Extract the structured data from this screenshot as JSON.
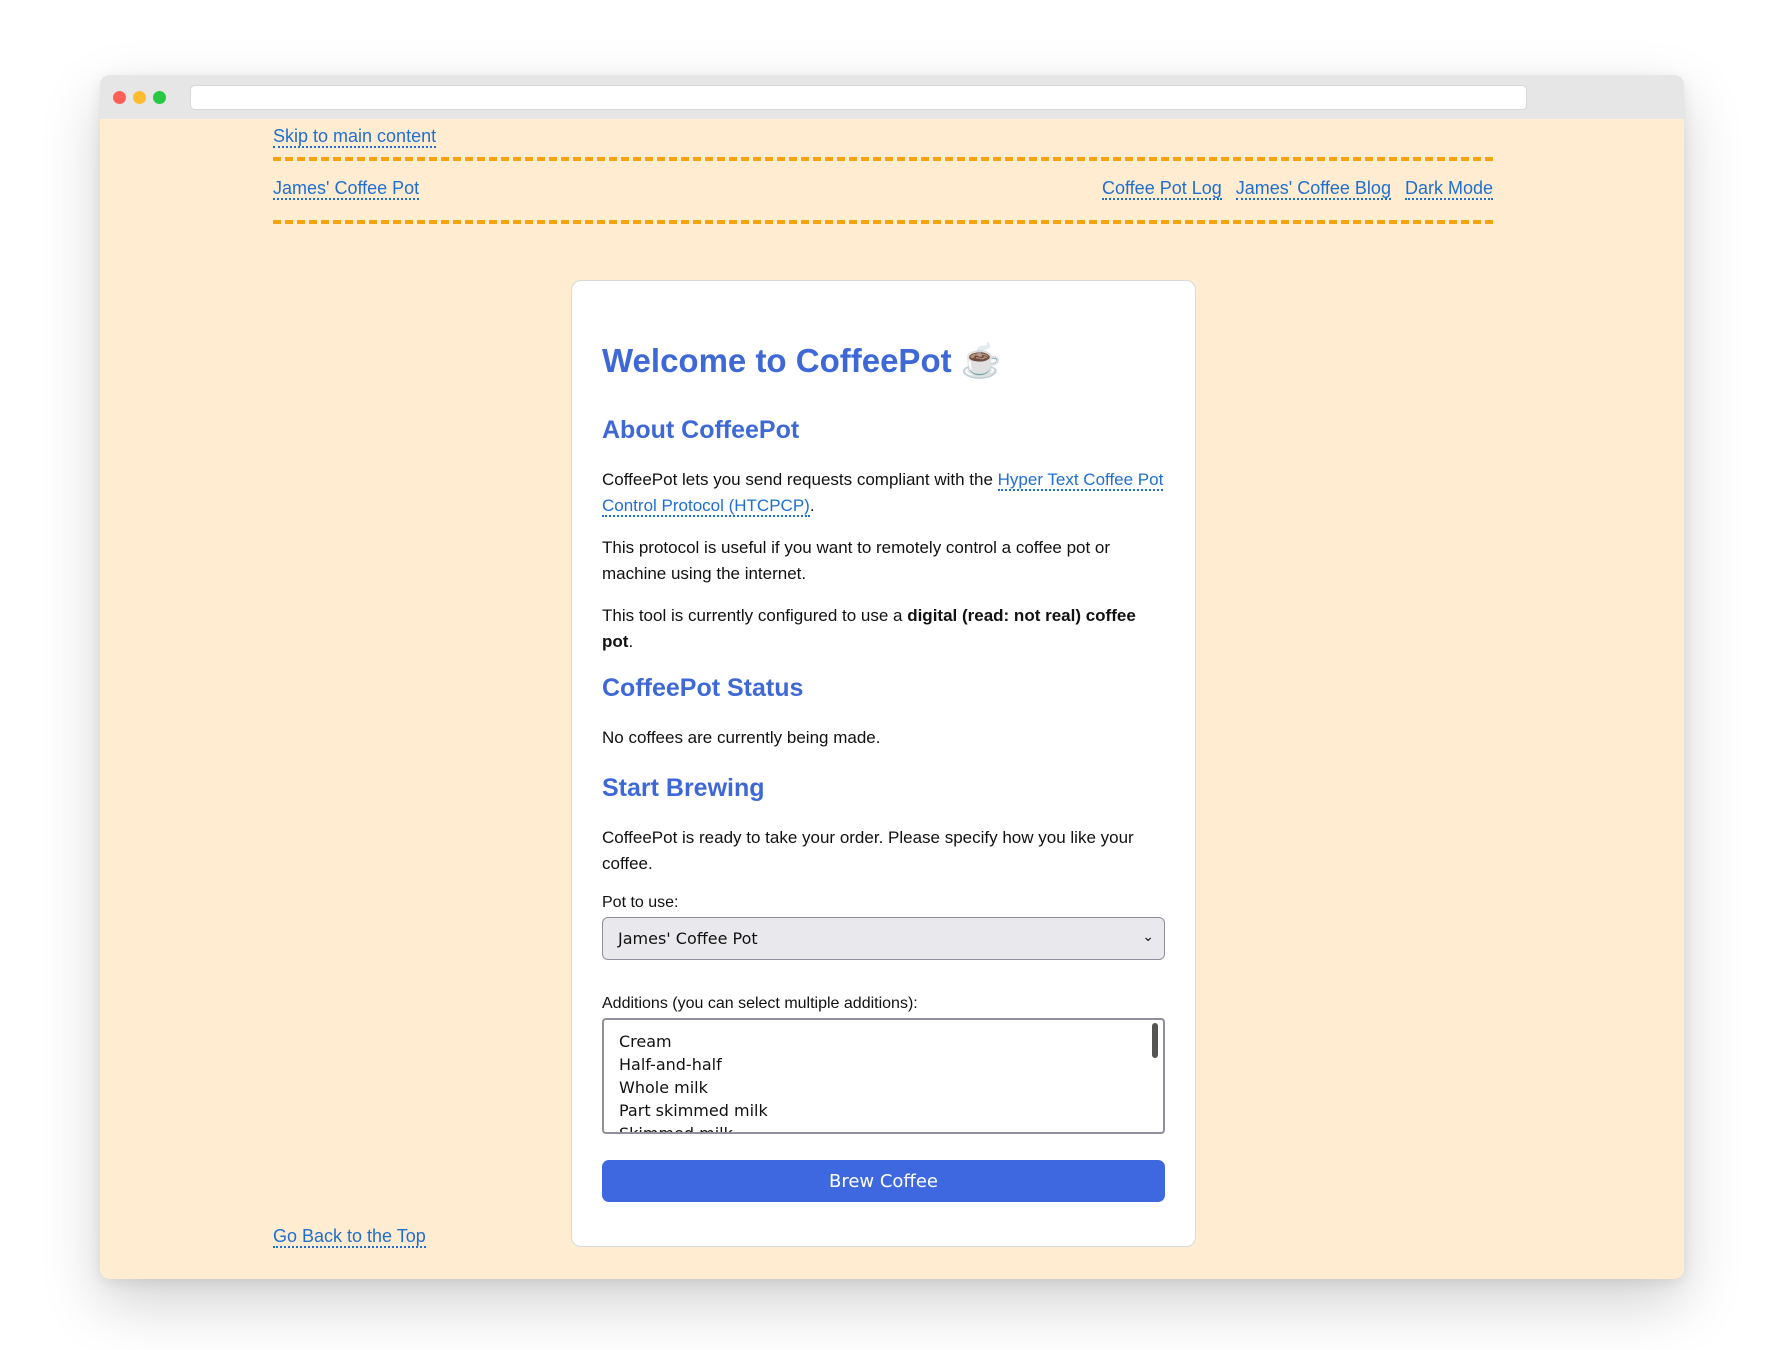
{
  "skip_link": "Skip to main content",
  "nav": {
    "home": "James' Coffee Pot",
    "links": [
      "Coffee Pot Log",
      "James' Coffee Blog",
      "Dark Mode"
    ]
  },
  "main": {
    "title": "Welcome to CoffeePot ☕",
    "about": {
      "heading": "About CoffeePot",
      "p1_before": "CoffeePot lets you send requests compliant with the ",
      "p1_link": "Hyper Text Coffee Pot Control Protocol (HTCPCP)",
      "p1_after": ".",
      "p2": "This protocol is useful if you want to remotely control a coffee pot or machine using the internet.",
      "p3_before": "This tool is currently configured to use a ",
      "p3_bold": "digital (read: not real) coffee pot",
      "p3_after": "."
    },
    "status": {
      "heading": "CoffeePot Status",
      "text": "No coffees are currently being made."
    },
    "brew": {
      "heading": "Start Brewing",
      "intro": "CoffeePot is ready to take your order. Please specify how you like your coffee.",
      "pot_label": "Pot to use:",
      "pot_value": "James' Coffee Pot",
      "additions_label": "Additions (you can select multiple additions):",
      "additions": [
        "Cream",
        "Half-and-half",
        "Whole milk",
        "Part skimmed milk",
        "Skimmed milk"
      ],
      "button": "Brew Coffee"
    }
  },
  "footer_link": "Go Back to the Top",
  "colors": {
    "page_background": "#ffecd1",
    "accent": "#3e68d6",
    "link": "#1f6fd0",
    "nav_border": "#f5a30f",
    "button": "#3e68e0"
  }
}
